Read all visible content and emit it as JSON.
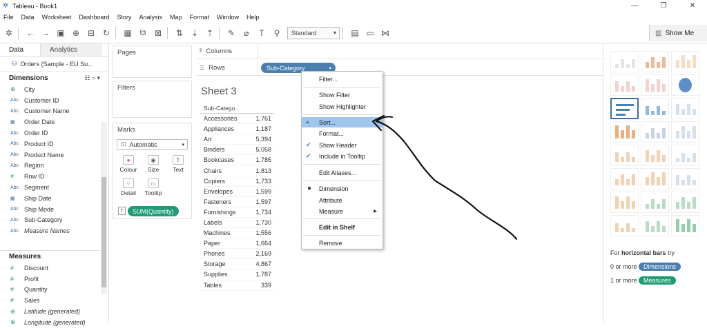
{
  "window": {
    "title": "Tableau - Book1",
    "controls": [
      "—",
      "❐",
      "✕"
    ]
  },
  "menu": [
    "File",
    "Data",
    "Worksheet",
    "Dashboard",
    "Story",
    "Analysis",
    "Map",
    "Format",
    "Window",
    "Help"
  ],
  "toolbar": {
    "fit_select": "Standard",
    "show_me_label": "Show Me"
  },
  "data_pane": {
    "tab_data": "Data",
    "tab_analytics": "Analytics",
    "datasource": "Orders (Sample - EU Su...",
    "dimensions_label": "Dimensions",
    "dimensions": [
      {
        "type": "globe",
        "name": "City"
      },
      {
        "type": "Abc",
        "name": "Customer ID"
      },
      {
        "type": "Abc",
        "name": "Customer Name"
      },
      {
        "type": "date",
        "name": "Order Date"
      },
      {
        "type": "Abc",
        "name": "Order ID"
      },
      {
        "type": "Abc",
        "name": "Product ID"
      },
      {
        "type": "Abc",
        "name": "Product Name"
      },
      {
        "type": "Abc",
        "name": "Region"
      },
      {
        "type": "#",
        "name": "Row ID"
      },
      {
        "type": "Abc",
        "name": "Segment"
      },
      {
        "type": "date",
        "name": "Ship Date"
      },
      {
        "type": "Abc",
        "name": "Ship Mode"
      },
      {
        "type": "Abc",
        "name": "Sub-Category"
      },
      {
        "type": "Abc",
        "name": "Measure Names"
      }
    ],
    "measures_label": "Measures",
    "measures": [
      {
        "type": "#",
        "name": "Discount"
      },
      {
        "type": "#",
        "name": "Profit"
      },
      {
        "type": "#",
        "name": "Quantity"
      },
      {
        "type": "#",
        "name": "Sales"
      },
      {
        "type": "globe",
        "name": "Latitude (generated)"
      },
      {
        "type": "globe",
        "name": "Longitude (generated)"
      }
    ]
  },
  "cards": {
    "pages": "Pages",
    "filters": "Filters",
    "marks": "Marks",
    "mark_type": "Automatic",
    "mark_buttons": [
      "Colour",
      "Size",
      "Text",
      "Detail",
      "Tooltip"
    ],
    "mark_pill": "SUM(Quantity)"
  },
  "shelves": {
    "columns": "Columns",
    "rows": "Rows",
    "rows_pill": "Sub-Category"
  },
  "sheet": {
    "title": "Sheet 3",
    "column_header": "Sub-Catego..",
    "rows": [
      {
        "cat": "Accessories",
        "val": "1,761"
      },
      {
        "cat": "Appliances",
        "val": "1,187"
      },
      {
        "cat": "Art",
        "val": "5,394"
      },
      {
        "cat": "Binders",
        "val": "5,058"
      },
      {
        "cat": "Bookcases",
        "val": "1,785"
      },
      {
        "cat": "Chairs",
        "val": "1,813"
      },
      {
        "cat": "Copiers",
        "val": "1,733"
      },
      {
        "cat": "Envelopes",
        "val": "1,599"
      },
      {
        "cat": "Fasteners",
        "val": "1,597"
      },
      {
        "cat": "Furnishings",
        "val": "1,734"
      },
      {
        "cat": "Labels",
        "val": "1,730"
      },
      {
        "cat": "Machines",
        "val": "1,556"
      },
      {
        "cat": "Paper",
        "val": "1,664"
      },
      {
        "cat": "Phones",
        "val": "2,169"
      },
      {
        "cat": "Storage",
        "val": "4,867"
      },
      {
        "cat": "Supplies",
        "val": "1,787"
      },
      {
        "cat": "Tables",
        "val": "339"
      }
    ]
  },
  "context_menu": {
    "filter": "Filter...",
    "show_filter": "Show Filter",
    "show_highlighter": "Show Highlighter",
    "sort": "Sort...",
    "format": "Format...",
    "show_header": "Show Header",
    "include_tooltip": "Include in Tooltip",
    "edit_aliases": "Edit Aliases...",
    "dimension": "Dimension",
    "attribute": "Attribute",
    "measure": "Measure",
    "edit_in_shelf": "Edit in Shelf",
    "remove": "Remove"
  },
  "show_me": {
    "hint_prefix": "For ",
    "hint_bold": "horizontal bars",
    "hint_suffix": " try",
    "dims_prefix": "0 or more",
    "dims_pill": "Dimensions",
    "meas_prefix": "1 or more",
    "meas_pill": "Measures"
  }
}
